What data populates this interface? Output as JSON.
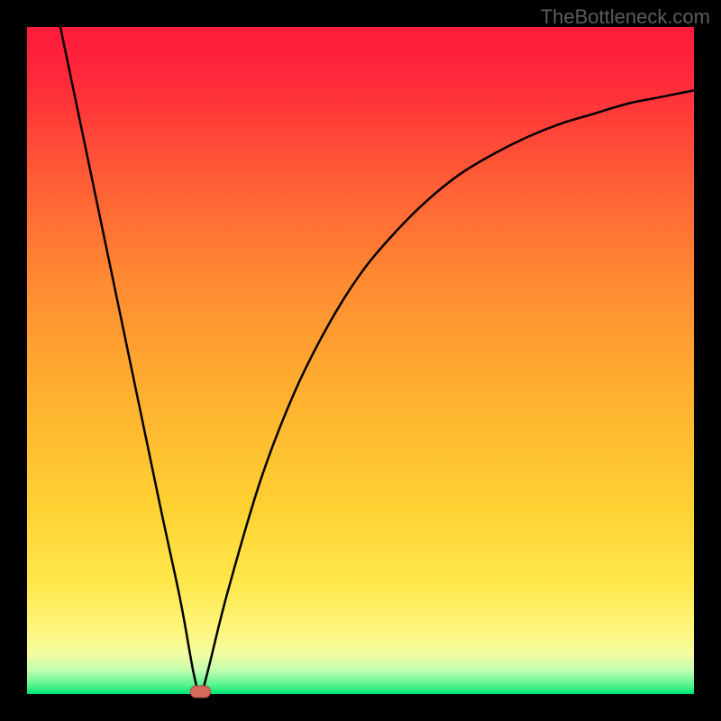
{
  "watermark": "TheBottleneck.com",
  "chart_data": {
    "type": "line",
    "title": "",
    "xlabel": "",
    "ylabel": "",
    "x_range": [
      0,
      100
    ],
    "y_range": [
      0,
      100
    ],
    "min_point": {
      "x": 26,
      "y": 0
    },
    "series": [
      {
        "name": "curve",
        "points": [
          {
            "x": 5,
            "y": 100
          },
          {
            "x": 10,
            "y": 76
          },
          {
            "x": 15,
            "y": 52
          },
          {
            "x": 20,
            "y": 28
          },
          {
            "x": 23,
            "y": 14
          },
          {
            "x": 25,
            "y": 3
          },
          {
            "x": 26,
            "y": 0
          },
          {
            "x": 27,
            "y": 3
          },
          {
            "x": 30,
            "y": 15
          },
          {
            "x": 35,
            "y": 32
          },
          {
            "x": 40,
            "y": 45
          },
          {
            "x": 45,
            "y": 55
          },
          {
            "x": 50,
            "y": 63
          },
          {
            "x": 55,
            "y": 69
          },
          {
            "x": 60,
            "y": 74
          },
          {
            "x": 65,
            "y": 78
          },
          {
            "x": 70,
            "y": 81
          },
          {
            "x": 75,
            "y": 83.5
          },
          {
            "x": 80,
            "y": 85.5
          },
          {
            "x": 85,
            "y": 87
          },
          {
            "x": 90,
            "y": 88.5
          },
          {
            "x": 95,
            "y": 89.5
          },
          {
            "x": 100,
            "y": 90.5
          }
        ]
      }
    ],
    "background_gradient": {
      "top": "#ff1744",
      "mid": "#ffb300",
      "low": "#ffee58",
      "bottom": "#00e676"
    },
    "frame_color": "#000000",
    "frame_width": 30,
    "marker": {
      "fill": "#d46a5c",
      "stroke": "#b04a3c"
    }
  }
}
